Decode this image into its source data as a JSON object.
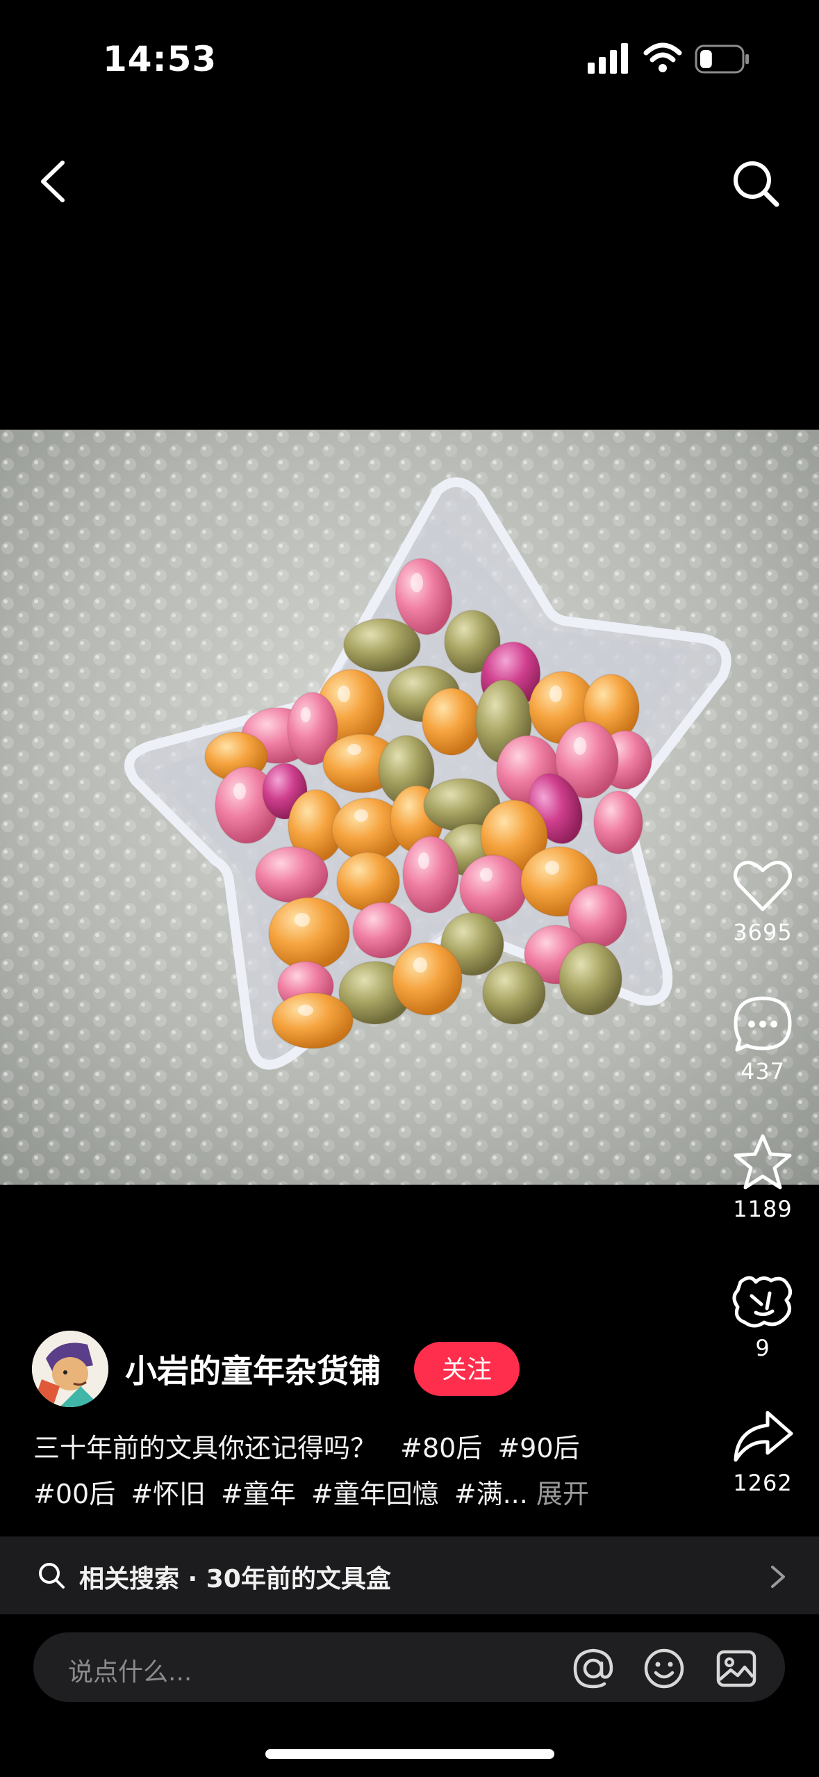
{
  "status_bar": {
    "time": "14:53",
    "battery_level": 0.3
  },
  "post": {
    "author_name": "小岩的童年杂货铺",
    "follow_label": "关注",
    "caption_text": "三十年前的文具你还记得吗？",
    "hashtags": [
      "#80后",
      "#90后",
      "#00后",
      "#怀旧",
      "#童年",
      "#童年回憶",
      "#满..."
    ],
    "expand_label": "展开"
  },
  "actions": {
    "likes": "3695",
    "comments": "437",
    "favorites": "1189",
    "gifts": "9",
    "shares": "1262"
  },
  "related_search": {
    "label": "相关搜索 · 30年前的文具盒"
  },
  "comment_bar": {
    "placeholder": "说点什么..."
  },
  "icons": [
    "back-arrow-icon",
    "search-icon",
    "heart-icon",
    "comment-icon",
    "star-icon",
    "gift-icon",
    "share-icon",
    "mention-icon",
    "emoji-icon",
    "image-icon",
    "chevron-right-icon"
  ],
  "colors": {
    "follow_bg": "#ff2e4d",
    "background": "#000000"
  }
}
